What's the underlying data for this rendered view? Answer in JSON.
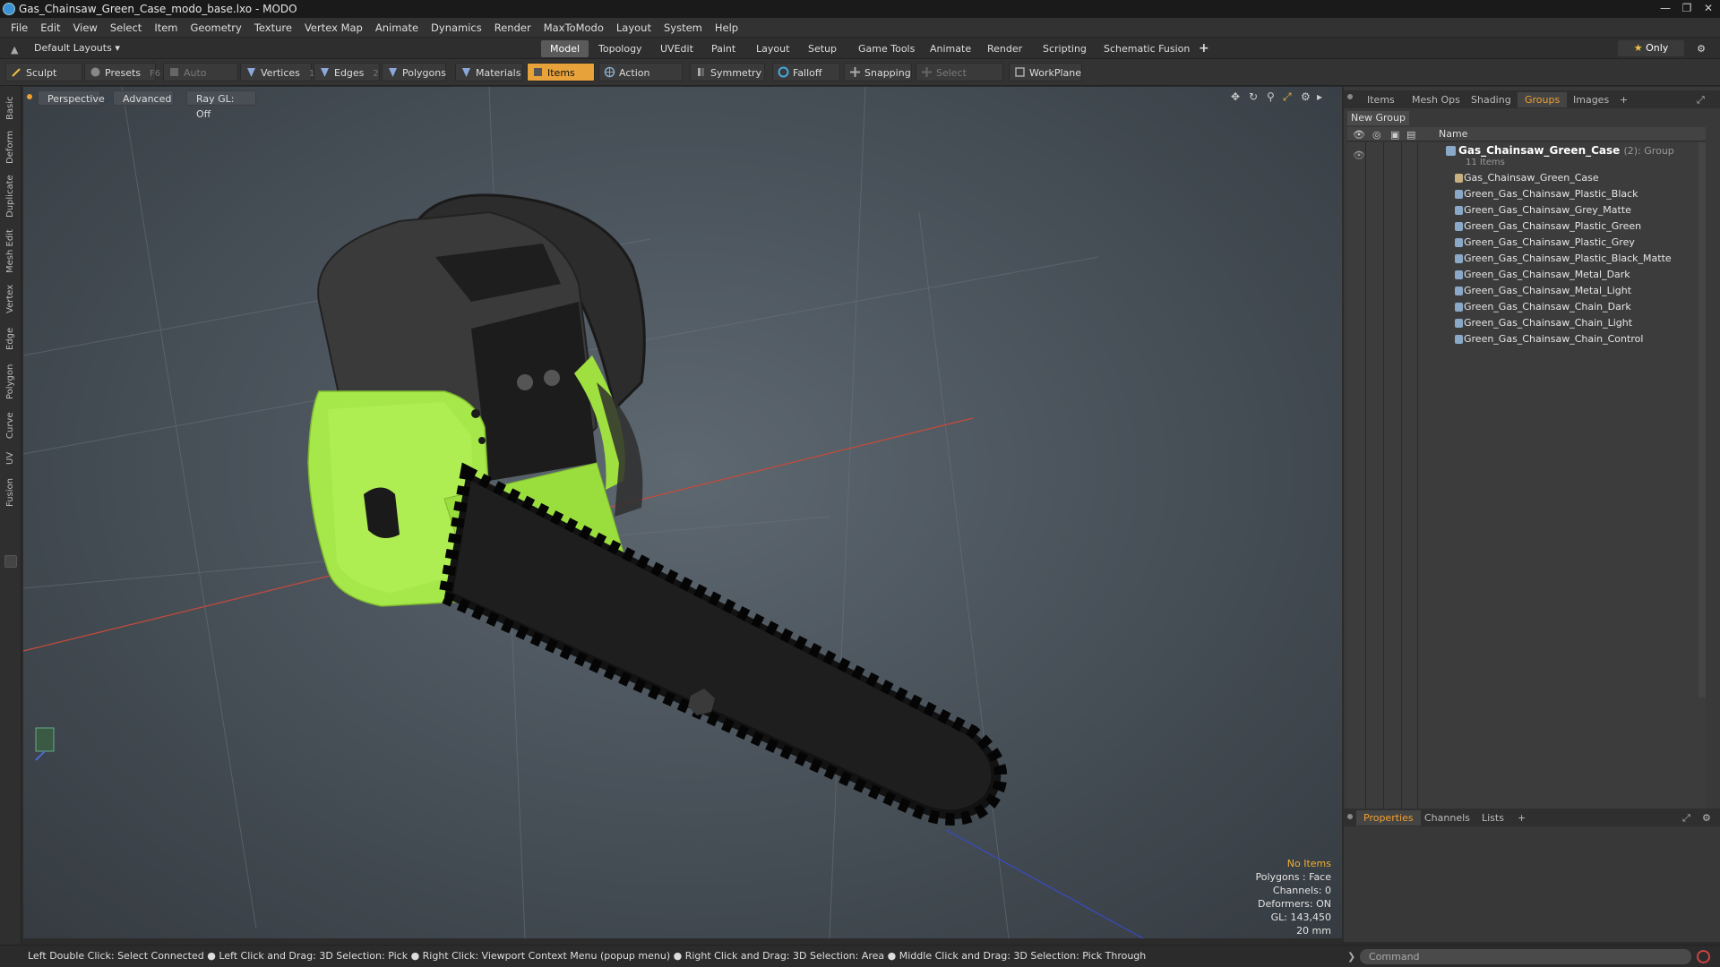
{
  "window": {
    "title": "Gas_Chainsaw_Green_Case_modo_base.lxo - MODO",
    "controls": [
      "minimize-icon",
      "restore-icon",
      "close-icon"
    ]
  },
  "menu": [
    "File",
    "Edit",
    "View",
    "Select",
    "Item",
    "Geometry",
    "Texture",
    "Vertex Map",
    "Animate",
    "Dynamics",
    "Render",
    "MaxToModo",
    "Layout",
    "System",
    "Help"
  ],
  "layout_selector": "Default Layouts",
  "layout_tabs": [
    "Model",
    "Topology",
    "UVEdit",
    "Paint",
    "Layout",
    "Setup",
    "Game Tools",
    "Animate",
    "Render",
    "Scripting",
    "Schematic Fusion"
  ],
  "layout_tabs_active": "Model",
  "only_button": "Only",
  "toolbar": {
    "sculpt": "Sculpt",
    "presets": "Presets",
    "presets_hotkey": "F6",
    "auto_select": "Auto Select",
    "vertices": "Vertices",
    "vertices_count": "1",
    "edges": "Edges",
    "edges_count": "2",
    "polygons": "Polygons",
    "materials": "Materials",
    "items": "Items",
    "action_center": "Action Center",
    "symmetry": "Symmetry",
    "falloff": "Falloff",
    "snapping": "Snapping",
    "select_through": "Select Through",
    "workplane": "WorkPlane"
  },
  "left_tabs": [
    "Basic",
    "Deform",
    "Duplicate",
    "Mesh Edit",
    "Vertex",
    "Edge",
    "Polygon",
    "Curve",
    "UV",
    "Fusion"
  ],
  "viewport": {
    "perspective": "Perspective",
    "advanced": "Advanced",
    "raygl": "Ray GL: Off",
    "stats": {
      "no_items": "No Items",
      "polygons": "Polygons : Face",
      "channels": "Channels: 0",
      "deformers": "Deformers: ON",
      "gl": "GL: 143,450",
      "scale": "20 mm"
    },
    "colors": {
      "case_green": "#a6e84a",
      "body_dark": "#2b2b2b",
      "chain": "#111111"
    }
  },
  "right_panel": {
    "tabs": [
      "Items",
      "Mesh Ops",
      "Shading",
      "Groups",
      "Images"
    ],
    "active_tab": "Groups",
    "new_group": "New Group",
    "column_name": "Name",
    "group": {
      "name": "Gas_Chainsaw_Green_Case",
      "count_label": "(2)",
      "type_label": ": Group",
      "items_label": "11 Items"
    },
    "items": [
      "Gas_Chainsaw_Green_Case",
      "Green_Gas_Chainsaw_Plastic_Black",
      "Green_Gas_Chainsaw_Grey_Matte",
      "Green_Gas_Chainsaw_Plastic_Green",
      "Green_Gas_Chainsaw_Plastic_Grey",
      "Green_Gas_Chainsaw_Plastic_Black_Matte",
      "Green_Gas_Chainsaw_Metal_Dark",
      "Green_Gas_Chainsaw_Metal_Light",
      "Green_Gas_Chainsaw_Chain_Dark",
      "Green_Gas_Chainsaw_Chain_Light",
      "Green_Gas_Chainsaw_Chain_Control"
    ],
    "bottom_tabs": [
      "Properties",
      "Channels",
      "Lists"
    ],
    "bottom_active": "Properties"
  },
  "status": {
    "hint": "Left Double Click: Select Connected ● Left Click and Drag: 3D Selection: Pick ● Right Click: Viewport Context Menu (popup menu) ● Right Click and Drag: 3D Selection: Area ● Middle Click and Drag: 3D Selection: Pick Through",
    "command_placeholder": "Command"
  }
}
